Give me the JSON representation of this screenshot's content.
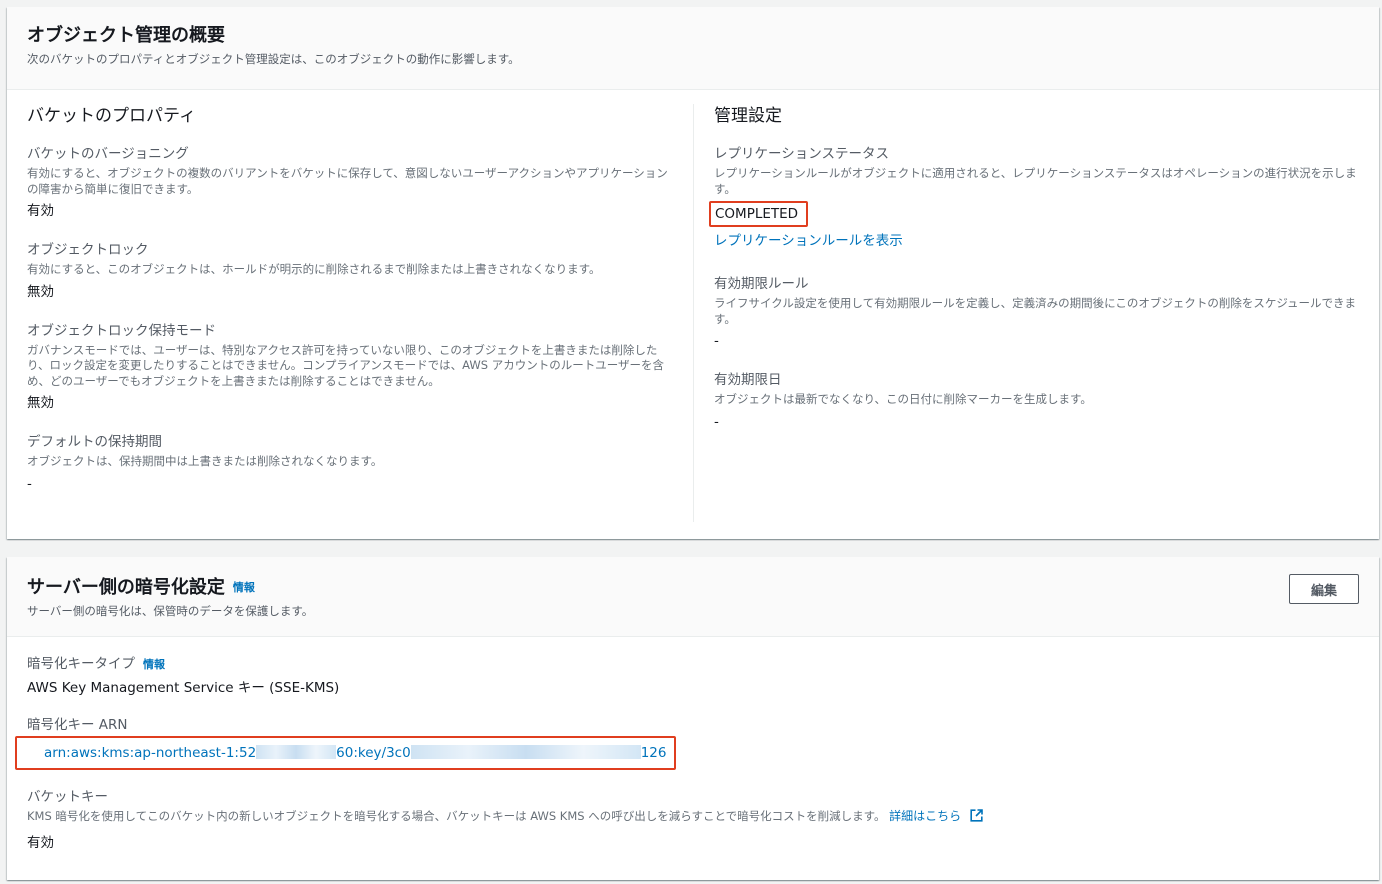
{
  "overview": {
    "title": "オブジェクト管理の概要",
    "description": "次のバケットのプロパティとオブジェクト管理設定は、このオブジェクトの動作に影響します。",
    "bucket_props": {
      "title": "バケットのプロパティ",
      "versioning": {
        "label": "バケットのバージョニング",
        "description": "有効にすると、オブジェクトの複数のバリアントをバケットに保存して、意図しないユーザーアクションやアプリケーションの障害から簡単に復旧できます。",
        "value": "有効"
      },
      "object_lock": {
        "label": "オブジェクトロック",
        "description": "有効にすると、このオブジェクトは、ホールドが明示的に削除されるまで削除または上書きされなくなります。",
        "value": "無効"
      },
      "lock_mode": {
        "label": "オブジェクトロック保持モード",
        "description": "ガバナンスモードでは、ユーザーは、特別なアクセス許可を持っていない限り、このオブジェクトを上書きまたは削除したり、ロック設定を変更したりすることはできません。コンプライアンスモードでは、AWS アカウントのルートユーザーを含め、どのユーザーでもオブジェクトを上書きまたは削除することはできません。",
        "value": "無効"
      },
      "retention": {
        "label": "デフォルトの保持期間",
        "description": "オブジェクトは、保持期間中は上書きまたは削除されなくなります。",
        "value": "-"
      }
    },
    "mgmt": {
      "title": "管理設定",
      "replication": {
        "label": "レプリケーションステータス",
        "description": "レプリケーションルールがオブジェクトに適用されると、レプリケーションステータスはオペレーションの進行状況を示します。",
        "value": "COMPLETED",
        "link": "レプリケーションルールを表示"
      },
      "expiration_rule": {
        "label": "有効期限ルール",
        "description": "ライフサイクル設定を使用して有効期限ルールを定義し、定義済みの期間後にこのオブジェクトの削除をスケジュールできます。",
        "value": "-"
      },
      "expiration_date": {
        "label": "有効期限日",
        "description": "オブジェクトは最新でなくなり、この日付に削除マーカーを生成します。",
        "value": "-"
      }
    }
  },
  "encryption": {
    "title": "サーバー側の暗号化設定",
    "info": "情報",
    "description": "サーバー側の暗号化は、保管時のデータを保護します。",
    "edit": "編集",
    "key_type": {
      "label": "暗号化キータイプ",
      "info": "情報",
      "value": "AWS Key Management Service キー (SSE-KMS)"
    },
    "key_arn": {
      "label": "暗号化キー ARN",
      "part1": "arn:aws:kms:ap-northeast-1:52",
      "part2": "60:key/3c0",
      "part3": "126"
    },
    "bucket_key": {
      "label": "バケットキー",
      "description": "KMS 暗号化を使用してこのバケット内の新しいオブジェクトを暗号化する場合、バケットキーは AWS KMS への呼び出しを減らすことで暗号化コストを削減します。",
      "link": "詳細はこちら",
      "value": "有効"
    }
  },
  "colors": {
    "link": "#0073bb",
    "highlight": "#e03e1f",
    "background": "#f2f3f3"
  }
}
